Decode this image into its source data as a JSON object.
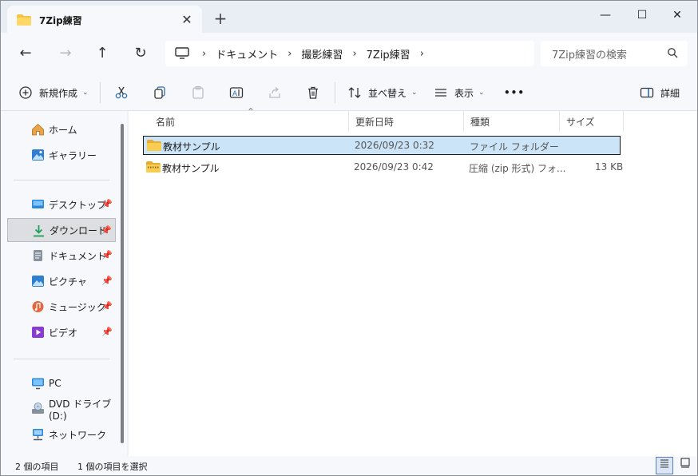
{
  "window": {
    "tab_title": "7Zip練習",
    "tab_close": "✕",
    "new_tab": "+",
    "minimize": "—",
    "maximize": "☐",
    "close": "✕"
  },
  "nav": {
    "back": "←",
    "forward": "→",
    "up": "↑",
    "refresh": "↻",
    "breadcrumbs": [
      "ドキュメント",
      "撮影練習",
      "7Zip練習"
    ],
    "separator": "›",
    "search_placeholder": "7Zip練習の検索"
  },
  "commands": {
    "new": "新規作成",
    "sort": "並べ替え",
    "view": "表示",
    "more": "•••",
    "details": "詳細"
  },
  "sidebar": {
    "quick": [
      {
        "label": "ホーム",
        "icon": "home-icon"
      },
      {
        "label": "ギャラリー",
        "icon": "gallery-icon"
      }
    ],
    "pinned": [
      {
        "label": "デスクトップ",
        "icon": "desktop-icon",
        "color": "#2b88d8"
      },
      {
        "label": "ダウンロード",
        "icon": "download-icon",
        "color": "#1e9e5a"
      },
      {
        "label": "ドキュメント",
        "icon": "document-icon",
        "color": "#6b7380"
      },
      {
        "label": "ピクチャ",
        "icon": "pictures-icon",
        "color": "#2f7fd1"
      },
      {
        "label": "ミュージック",
        "icon": "music-icon",
        "color": "#e3683f"
      },
      {
        "label": "ビデオ",
        "icon": "video-icon",
        "color": "#8a3bd1"
      }
    ],
    "drives": [
      {
        "label": "PC",
        "icon": "pc-icon"
      },
      {
        "label": "DVD ドライブ (D:)",
        "icon": "dvd-drive-icon"
      },
      {
        "label": "ネットワーク",
        "icon": "network-icon"
      }
    ]
  },
  "table": {
    "columns": [
      "名前",
      "更新日時",
      "種類",
      "サイズ"
    ],
    "rows": [
      {
        "name": "教材サンプル",
        "modified": "2026/09/23 0:32",
        "type": "ファイル フォルダー",
        "size": "",
        "icon": "folder-icon"
      },
      {
        "name": "教材サンプル",
        "modified": "2026/09/23 0:42",
        "type": "圧縮 (zip 形式) フォ...",
        "size": "13 KB",
        "icon": "zip-folder-icon"
      }
    ]
  },
  "status": {
    "count": "2 個の項目",
    "selected": "1 個の項目を選択"
  },
  "colors": {
    "accent": "#0067c0",
    "selection": "#cce4f7",
    "folder": "#f6c445"
  }
}
